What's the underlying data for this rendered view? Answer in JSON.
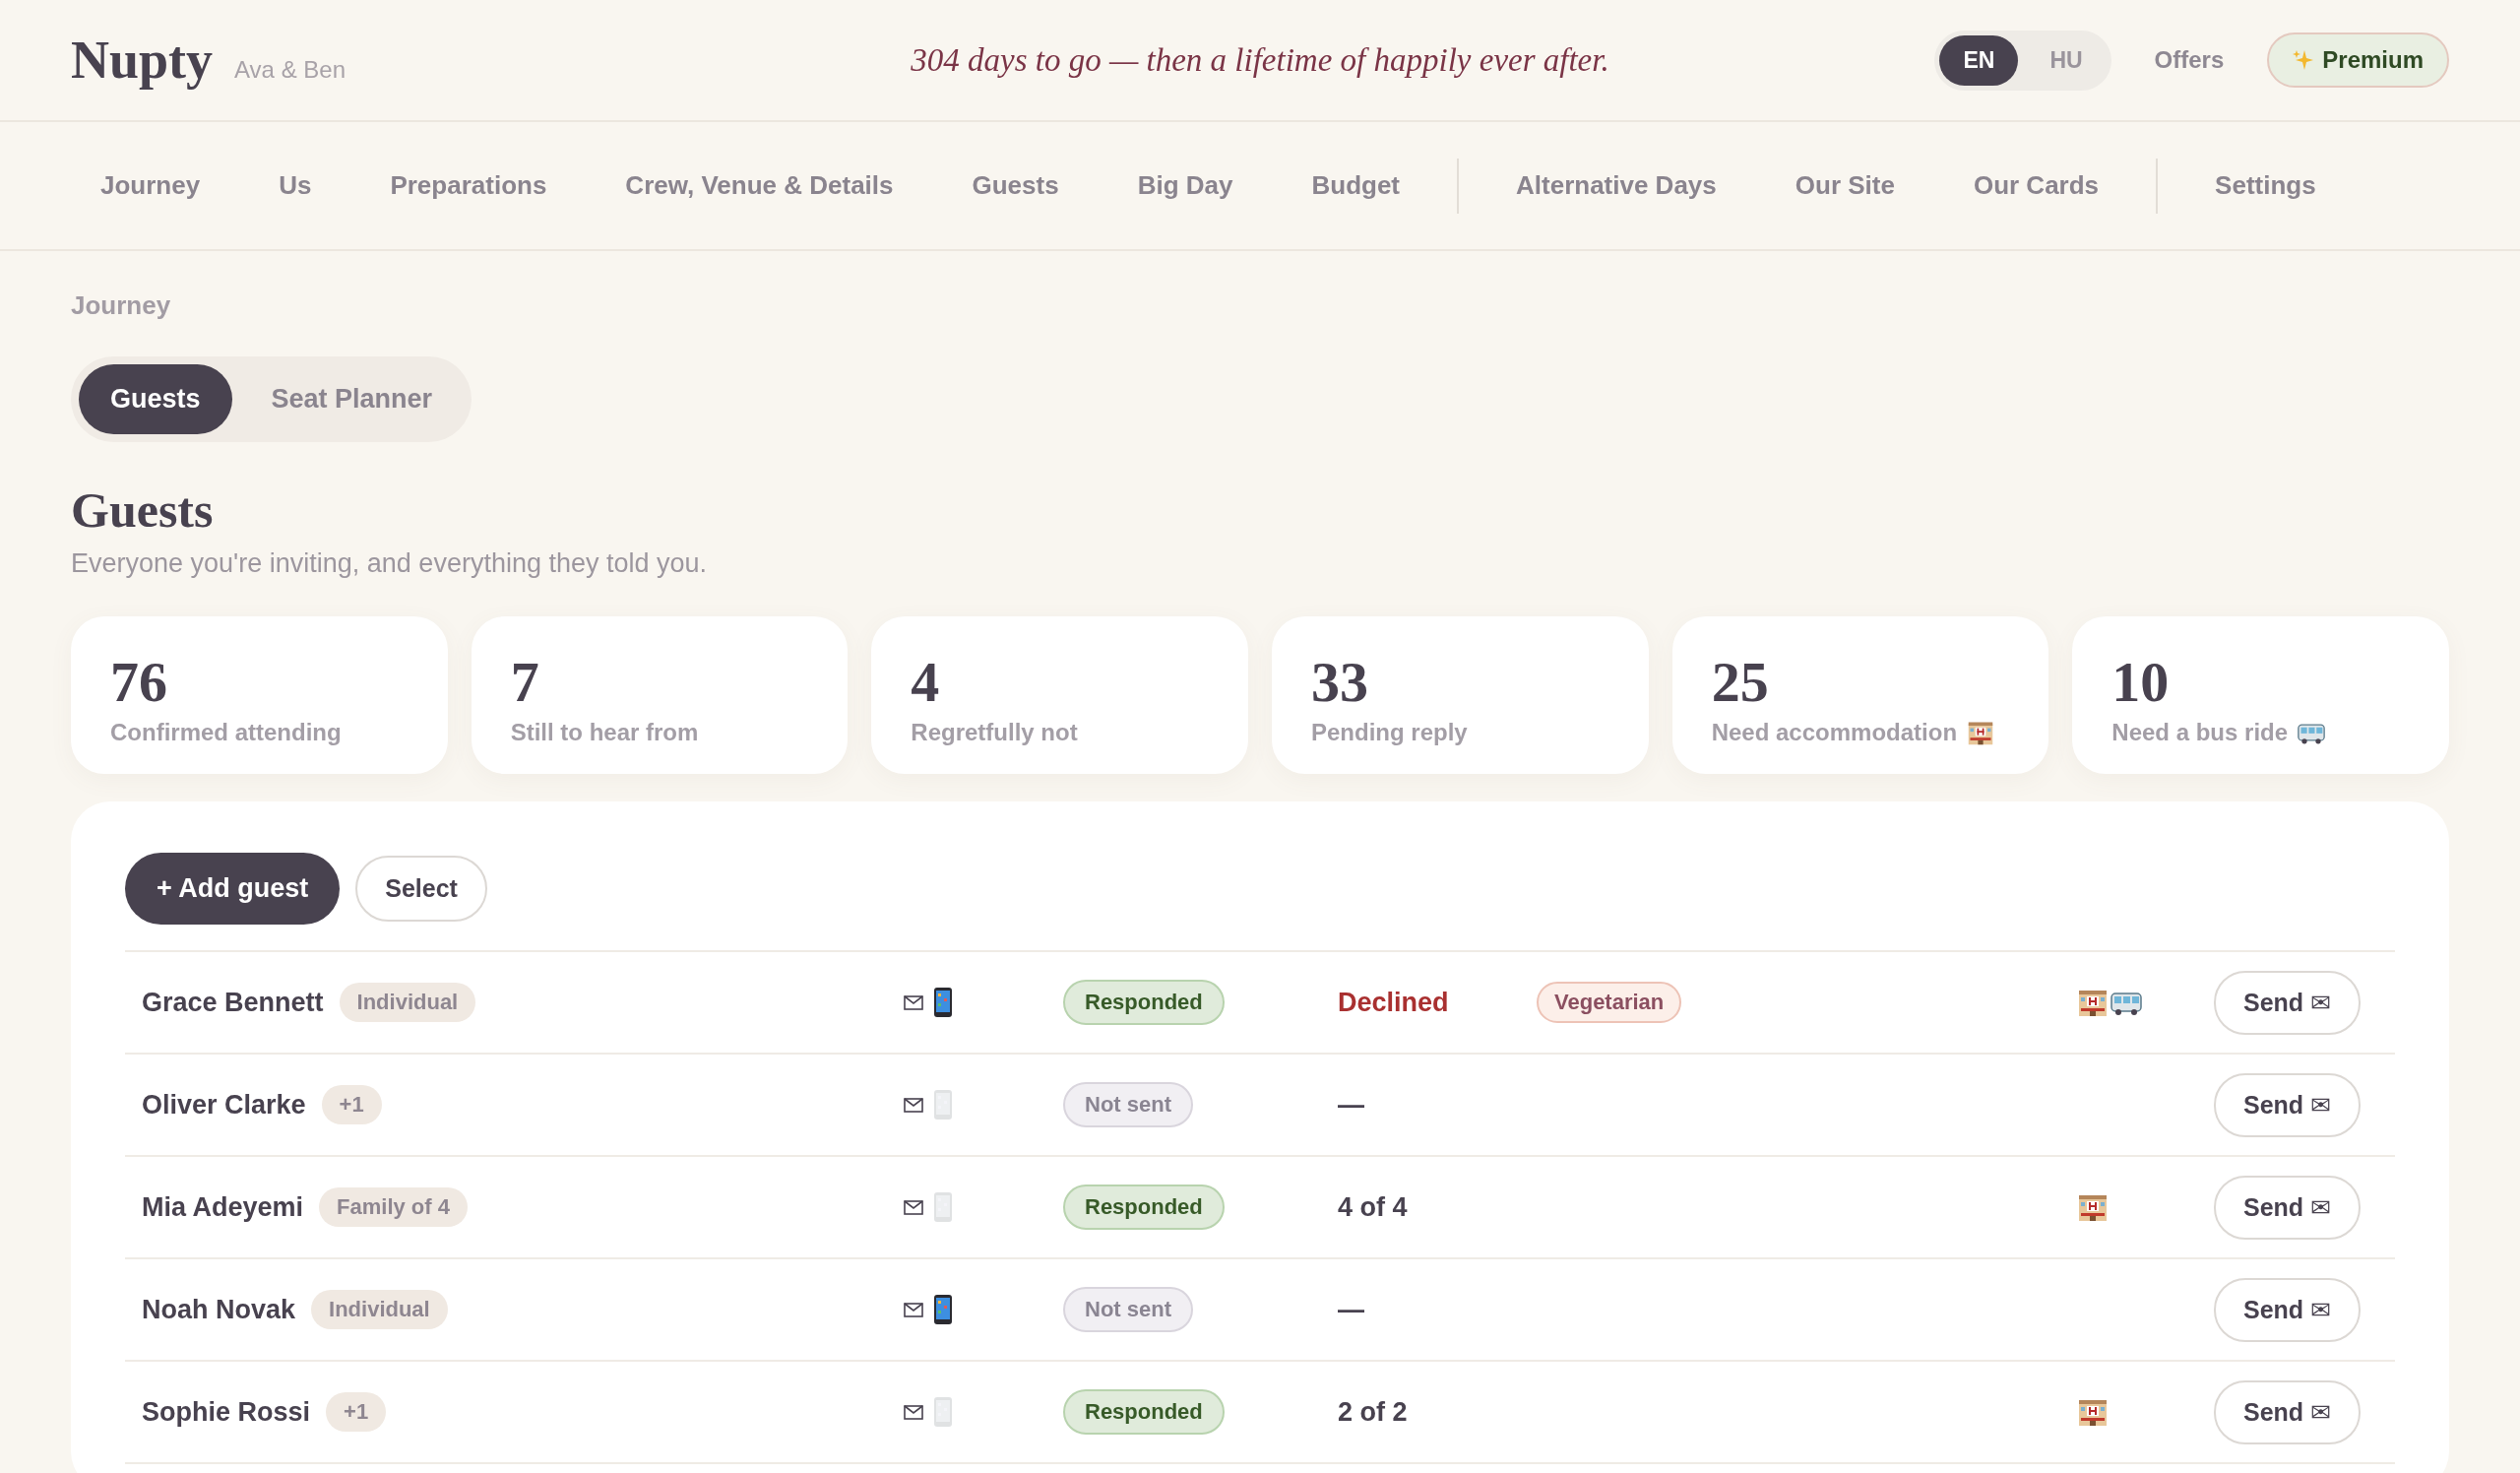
{
  "header": {
    "logo": "Nupty",
    "couple": "Ava & Ben",
    "tagline": "304 days to go — then a lifetime of happily ever after.",
    "languages": [
      {
        "label": "EN",
        "selected": true
      },
      {
        "label": "HU",
        "selected": false
      }
    ],
    "offers": "Offers",
    "premium": "Premium"
  },
  "nav": [
    [
      "Journey",
      "Us",
      "Preparations",
      "Crew, Venue & Details",
      "Guests",
      "Big Day",
      "Budget"
    ],
    [
      "Alternative Days",
      "Our Site",
      "Our Cards"
    ],
    [
      "Settings"
    ]
  ],
  "breadcrumb": "Journey",
  "subtabs": [
    {
      "label": "Guests",
      "selected": true
    },
    {
      "label": "Seat Planner",
      "selected": false
    }
  ],
  "page": {
    "title": "Guests",
    "subtitle": "Everyone you're inviting, and everything they told you."
  },
  "stats": [
    {
      "value": "76",
      "label": "Confirmed attending"
    },
    {
      "value": "7",
      "label": "Still to hear from"
    },
    {
      "value": "4",
      "label": "Regretfully not"
    },
    {
      "value": "33",
      "label": "Pending reply"
    },
    {
      "value": "25",
      "label": "Need accommodation",
      "kind": "accommodation"
    },
    {
      "value": "10",
      "label": "Need a bus ride",
      "kind": "bus"
    }
  ],
  "toolbar": {
    "add": "+ Add guest",
    "select": "Select"
  },
  "guests": [
    {
      "name": "Grace Bennett",
      "group": "Individual",
      "phone": true,
      "invite": {
        "label": "Responded",
        "kind": "responded"
      },
      "rsvp": {
        "text": "Declined",
        "kind": "declined"
      },
      "diet": "Vegetarian",
      "accommodation": true,
      "bus": true,
      "action": "Send ✉"
    },
    {
      "name": "Oliver Clarke",
      "group": "+1",
      "phone": false,
      "invite": {
        "label": "Not sent",
        "kind": "not_sent"
      },
      "rsvp": {
        "text": "—",
        "kind": "plain"
      },
      "accommodation": false,
      "bus": false,
      "action": "Send ✉"
    },
    {
      "name": "Mia Adeyemi",
      "group": "Family of 4",
      "phone": false,
      "invite": {
        "label": "Responded",
        "kind": "responded"
      },
      "rsvp": {
        "text": "4 of 4",
        "kind": "plain"
      },
      "accommodation": true,
      "bus": false,
      "action": "Send ✉"
    },
    {
      "name": "Noah Novak",
      "group": "Individual",
      "phone": true,
      "invite": {
        "label": "Not sent",
        "kind": "not_sent"
      },
      "rsvp": {
        "text": "—",
        "kind": "plain"
      },
      "accommodation": false,
      "bus": false,
      "action": "Send ✉"
    },
    {
      "name": "Sophie Rossi",
      "group": "+1",
      "phone": false,
      "invite": {
        "label": "Responded",
        "kind": "responded"
      },
      "rsvp": {
        "text": "2 of 2",
        "kind": "plain"
      },
      "accommodation": true,
      "bus": false,
      "action": "Send ✉"
    }
  ]
}
